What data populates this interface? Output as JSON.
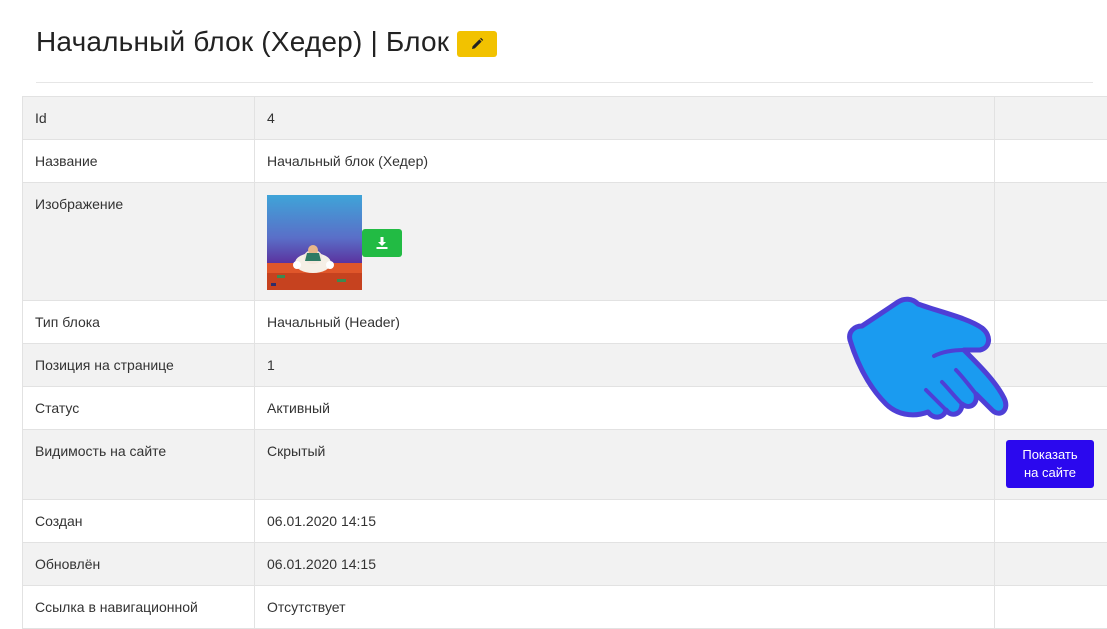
{
  "header": {
    "title": "Начальный блок (Хедер) | Блок",
    "edit_icon": "pencil-icon",
    "edit_color": "#f2c200"
  },
  "rows": [
    {
      "label": "Id",
      "value": "4"
    },
    {
      "label": "Название",
      "value": "Начальный блок (Хедер)"
    },
    {
      "label": "Изображение",
      "value": ""
    },
    {
      "label": "Тип блока",
      "value": "Начальный (Header)"
    },
    {
      "label": "Позиция на странице",
      "value": "1"
    },
    {
      "label": "Статус",
      "value": "Активный"
    },
    {
      "label": "Видимость на сайте",
      "value": "Скрытый"
    },
    {
      "label": "Создан",
      "value": "06.01.2020 14:15"
    },
    {
      "label": "Обновлён",
      "value": "06.01.2020 14:15"
    },
    {
      "label": "Ссылка в навигационной",
      "value": "Отсутствует"
    }
  ],
  "image": {
    "download_icon": "download-icon",
    "download_color": "#22bb44"
  },
  "actions": {
    "show_on_site_label": "Показать\nна сайте",
    "show_on_site_color": "#2b08ee"
  },
  "pointer": {
    "icon": "pointing-hand-icon",
    "color": "#1a9bf0"
  }
}
